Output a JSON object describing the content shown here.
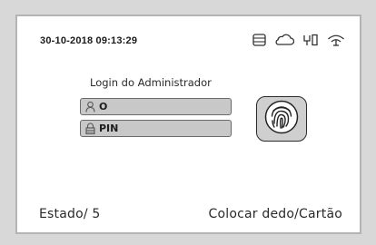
{
  "header": {
    "datetime": "30-10-2018  09:13:29",
    "icons": [
      "storage-icon",
      "cloud-icon",
      "ethernet-icon",
      "wifi-icon"
    ]
  },
  "login": {
    "title": "Login do Administrador",
    "user_value": "O",
    "pin_value": "PIN",
    "fingerprint_icon": "fingerprint-icon"
  },
  "footer": {
    "status": "Estado/  5",
    "hint": "Colocar dedo/Cartão"
  }
}
